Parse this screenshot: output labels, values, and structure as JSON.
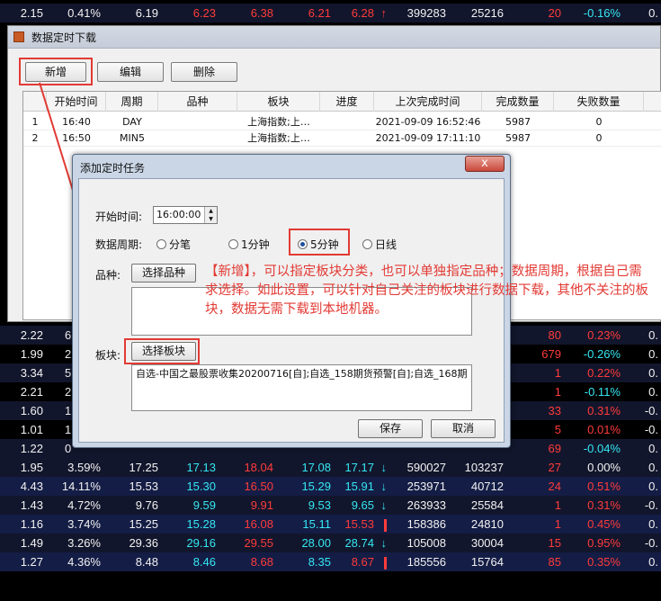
{
  "main_window": {
    "title": "数据定时下载",
    "toolbar": {
      "add_label": "新增",
      "edit_label": "编辑",
      "delete_label": "删除"
    },
    "columns": [
      "开始时间",
      "周期",
      "品种",
      "板块",
      "进度",
      "上次完成时间",
      "完成数量",
      "失败数量"
    ],
    "rows": [
      {
        "index": "1",
        "start": "16:40",
        "period": "DAY",
        "symbol": "",
        "sector": "上海指数;上…",
        "progress": "",
        "last_done": "2021-09-09 16:52:46",
        "done": "5987",
        "failed": "0"
      },
      {
        "index": "2",
        "start": "16:50",
        "period": "MIN5",
        "symbol": "",
        "sector": "上海指数;上…",
        "progress": "",
        "last_done": "2021-09-09 17:11:10",
        "done": "5987",
        "failed": "0"
      }
    ]
  },
  "dialog": {
    "title": "添加定时任务",
    "close_symbol": "x",
    "start_time_label": "开始时间:",
    "start_time_value": "16:00:00",
    "period_label": "数据周期:",
    "period_options": [
      "分笔",
      "1分钟",
      "5分钟",
      "日线"
    ],
    "period_selected": "5分钟",
    "symbol_label": "品种:",
    "select_symbol_label": "选择品种",
    "sector_label": "板块:",
    "select_sector_label": "选择板块",
    "sector_value": "自选-中国之最股票收集20200716[自];自选_158期货预警[自];自选_168期",
    "save_label": "保存",
    "cancel_label": "取消"
  },
  "annotation": "【新增】，可以指定板块分类，也可以单独指定品种；数据周期，根据自己需求选择。如此设置，可以针对自己关注的板块进行数据下载，其他不关注的板块，数据无需下载到本地机器。",
  "stock_top": {
    "c1": "2.15",
    "c2": "0.41%",
    "c3": "6.19",
    "c4": "6.23",
    "c5": "6.38",
    "c6": "6.21",
    "c7": "6.28",
    "c8": "399283",
    "c9": "25216",
    "c10": "20",
    "c11": "-0.16%",
    "c12": "0."
  },
  "stock_mid": [
    {
      "c1": "2.22",
      "c2": "6",
      "c10": "80",
      "c11": "0.23%",
      "c12": "0."
    },
    {
      "c1": "1.99",
      "c2": "2",
      "c10": "679",
      "c11": "-0.26%",
      "c12": "0."
    },
    {
      "c1": "3.34",
      "c2": "5",
      "c10": "1",
      "c11": "0.22%",
      "c12": "0."
    },
    {
      "c1": "2.21",
      "c2": "2",
      "c10": "1",
      "c11": "-0.11%",
      "c12": "0."
    },
    {
      "c1": "1.60",
      "c2": "1",
      "c10": "33",
      "c11": "0.31%",
      "c12": "-0."
    },
    {
      "c1": "1.01",
      "c2": "1",
      "c10": "5",
      "c11": "0.01%",
      "c12": "-0."
    },
    {
      "c1": "1.22",
      "c2": "0",
      "c10": "69",
      "c11": "-0.04%",
      "c12": "0."
    }
  ],
  "stock_bottom": [
    {
      "c1": "1.95",
      "c2": "3.59%",
      "c3": "17.25",
      "c4": "17.13",
      "c5": "18.04",
      "c6": "17.08",
      "c7": "17.17",
      "c8": "590027",
      "c9": "103237",
      "c10": "27",
      "c11": "0.00%",
      "c12": "0."
    },
    {
      "c1": "4.43",
      "c2": "14.11%",
      "c3": "15.53",
      "c4": "15.30",
      "c5": "16.50",
      "c6": "15.29",
      "c7": "15.91",
      "c8": "253971",
      "c9": "40712",
      "c10": "24",
      "c11": "0.51%",
      "c12": "0."
    },
    {
      "c1": "1.43",
      "c2": "4.72%",
      "c3": "9.76",
      "c4": "9.59",
      "c5": "9.91",
      "c6": "9.53",
      "c7": "9.65",
      "c8": "263933",
      "c9": "25584",
      "c10": "1",
      "c11": "0.31%",
      "c12": "-0."
    },
    {
      "c1": "1.16",
      "c2": "3.74%",
      "c3": "15.25",
      "c4": "15.28",
      "c5": "16.08",
      "c6": "15.11",
      "c7": "15.53",
      "c8": "158386",
      "c9": "24810",
      "c10": "1",
      "c11": "0.45%",
      "c12": "0."
    },
    {
      "c1": "1.49",
      "c2": "3.26%",
      "c3": "29.36",
      "c4": "29.16",
      "c5": "29.55",
      "c6": "28.00",
      "c7": "28.74",
      "c8": "105008",
      "c9": "30004",
      "c10": "15",
      "c11": "0.95%",
      "c12": "-0."
    },
    {
      "c1": "1.27",
      "c2": "4.36%",
      "c3": "8.48",
      "c4": "8.46",
      "c5": "8.68",
      "c6": "8.35",
      "c7": "8.67",
      "c8": "185556",
      "c9": "15764",
      "c10": "85",
      "c11": "0.35%",
      "c12": "0."
    }
  ],
  "colors": {
    "up": "#ff3b3b",
    "down": "#35e7f3",
    "highlight": "#e23a34",
    "grid_bg": "#000000"
  },
  "icons": {
    "up_arrow": "arrow-up-icon",
    "down_arrow": "arrow-down-icon",
    "app": "app-icon"
  }
}
